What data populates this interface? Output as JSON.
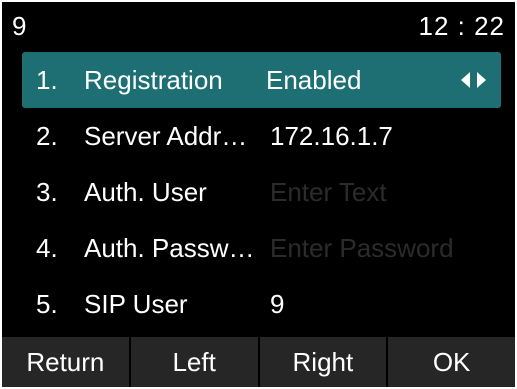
{
  "status": {
    "line_number": "9",
    "time": "12 : 22"
  },
  "items": [
    {
      "number": "1.",
      "label": "Registration",
      "value": "Enabled",
      "placeholder": ""
    },
    {
      "number": "2.",
      "label": "Server Addr…",
      "value": "172.16.1.7",
      "placeholder": ""
    },
    {
      "number": "3.",
      "label": "Auth. User",
      "value": "",
      "placeholder": "Enter Text"
    },
    {
      "number": "4.",
      "label": "Auth. Passw…",
      "value": "",
      "placeholder": "Enter Password"
    },
    {
      "number": "5.",
      "label": "SIP User",
      "value": "9",
      "placeholder": ""
    }
  ],
  "selected_index": 0,
  "softkeys": {
    "return": "Return",
    "left": "Left",
    "right": "Right",
    "ok": "OK"
  },
  "colors": {
    "selection": "#1d6f73",
    "background": "#000000",
    "softkey_bar": "#262626",
    "placeholder_text": "#2b2b2b"
  },
  "icons": {
    "selected_row": "left-right-arrows-icon"
  }
}
